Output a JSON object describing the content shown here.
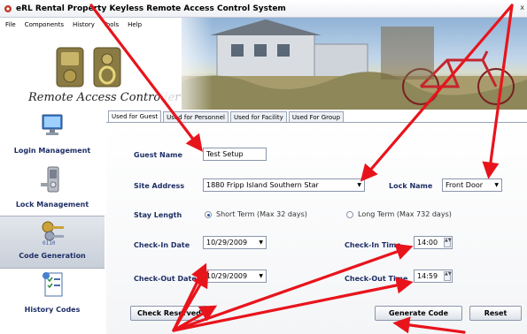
{
  "window": {
    "title": "eRL Rental Property Keyless Remote Access Control System",
    "close_glyph": "x"
  },
  "menu": [
    {
      "label": "File",
      "key": "F"
    },
    {
      "label": "Components",
      "key": "C"
    },
    {
      "label": "History",
      "key": "H"
    },
    {
      "label": "Tools",
      "key": "T"
    },
    {
      "label": "Help",
      "key": "H"
    }
  ],
  "banner": {
    "brand": "Remote Access Controller"
  },
  "sidebar": {
    "items": [
      {
        "label": "Login Management",
        "icon": "monitor-icon",
        "active": false
      },
      {
        "label": "Lock Management",
        "icon": "door-lock-icon",
        "active": false
      },
      {
        "label": "Code Generation",
        "icon": "keys-icon",
        "active": true
      },
      {
        "label": "History Codes",
        "icon": "document-icon",
        "active": false
      }
    ]
  },
  "tabs": [
    {
      "label": "Used for Guest",
      "active": true
    },
    {
      "label": "Used for Personnel",
      "active": false
    },
    {
      "label": "Used for Facility",
      "active": false
    },
    {
      "label": "Used For Group",
      "active": false
    }
  ],
  "form": {
    "guest_name": {
      "label": "Guest Name",
      "value": "Test Setup"
    },
    "site_address": {
      "label": "Site Address",
      "value": "1880 Fripp Island Southern Star"
    },
    "lock_name": {
      "label": "Lock Name",
      "value": "Front Door"
    },
    "stay_length": {
      "label": "Stay Length",
      "short": "Short Term (Max 32 days)",
      "long": "Long Term (Max 732 days)",
      "selected": "short"
    },
    "check_in_date": {
      "label": "Check-In Date",
      "value": "10/29/2009"
    },
    "check_in_time": {
      "label": "Check-In Time",
      "value": "14:00"
    },
    "check_out_date": {
      "label": "Check-Out Date",
      "value": "10/29/2009"
    },
    "check_out_time": {
      "label": "Check-Out Time",
      "value": "14:59"
    }
  },
  "buttons": {
    "check_reserved": "Check Reserved",
    "generate": "Generate Code",
    "reset": "Reset"
  },
  "annotation_color": "#e8141c",
  "colors": {
    "label_navy": "#1f2f66",
    "radio_dot": "#2c5aa0"
  }
}
